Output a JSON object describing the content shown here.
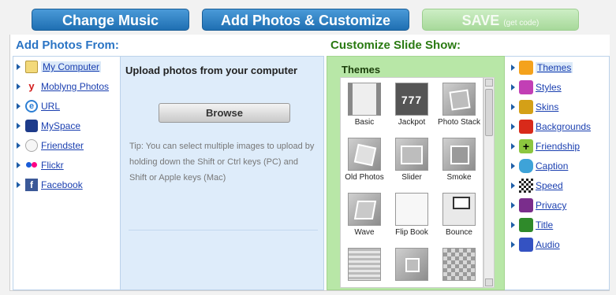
{
  "top_buttons": {
    "change_music": "Change Music",
    "add_photos": "Add Photos & Customize",
    "save": "SAVE",
    "save_sub": "(get code)"
  },
  "headers": {
    "add_photos_from": "Add Photos From:",
    "customize": "Customize Slide Show:"
  },
  "sources": [
    {
      "label": "My Computer",
      "icon": "folder-icon"
    },
    {
      "label": "Moblyng Photos",
      "icon": "moblyng-icon"
    },
    {
      "label": "URL",
      "icon": "ie-icon"
    },
    {
      "label": "MySpace",
      "icon": "myspace-icon"
    },
    {
      "label": "Friendster",
      "icon": "friendster-icon"
    },
    {
      "label": "Flickr",
      "icon": "flickr-icon"
    },
    {
      "label": "Facebook",
      "icon": "facebook-icon"
    }
  ],
  "upload": {
    "title": "Upload photos from your computer",
    "browse": "Browse",
    "tip": "Tip: You can select multiple images to upload by holding down the Shift or Ctrl keys (PC) and Shift or Apple keys (Mac)"
  },
  "themes_panel": {
    "title": "Themes",
    "items": [
      "Basic",
      "Jackpot",
      "Photo Stack",
      "Old Photos",
      "Slider",
      "Smoke",
      "Wave",
      "Flip Book",
      "Bounce"
    ]
  },
  "customize_options": [
    {
      "label": "Themes",
      "icon": "heart-icon",
      "color": "#f4a21c"
    },
    {
      "label": "Styles",
      "icon": "sparkle-icon",
      "color": "#c23fb5"
    },
    {
      "label": "Skins",
      "icon": "starburst-icon",
      "color": "#d4a017"
    },
    {
      "label": "Backgrounds",
      "icon": "fire-icon",
      "color": "#d82a1a"
    },
    {
      "label": "Friendship",
      "icon": "plus-icon",
      "color": "#8cc63f"
    },
    {
      "label": "Caption",
      "icon": "caption-icon",
      "color": "#3ea3d8"
    },
    {
      "label": "Speed",
      "icon": "checker-icon",
      "color": "#333333"
    },
    {
      "label": "Privacy",
      "icon": "lock-icon",
      "color": "#7a2d8c"
    },
    {
      "label": "Title",
      "icon": "binary-icon",
      "color": "#2f8a2a"
    },
    {
      "label": "Audio",
      "icon": "speaker-icon",
      "color": "#3452c2"
    }
  ]
}
